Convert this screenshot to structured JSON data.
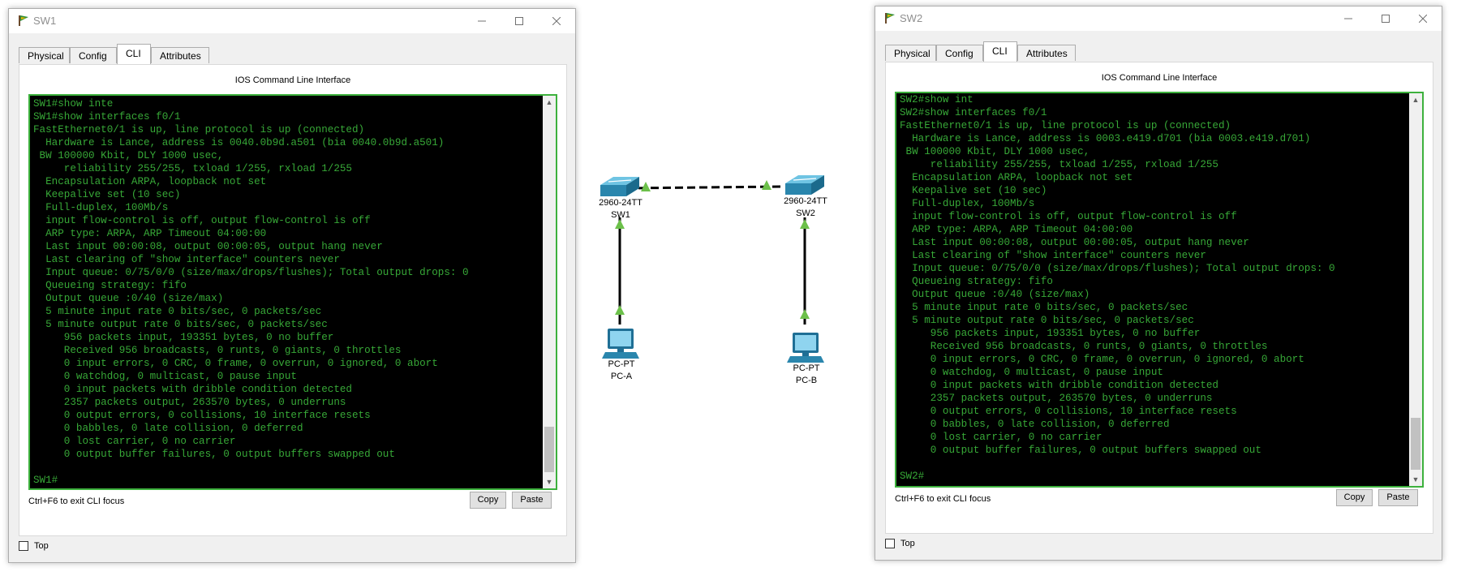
{
  "windows": [
    {
      "title": "SW1",
      "tabs": [
        "Physical",
        "Config",
        "CLI",
        "Attributes"
      ],
      "active_tab": "CLI",
      "panel_title": "IOS Command Line Interface",
      "terminal_lines": [
        "SW1#show inte",
        "SW1#show interfaces f0/1",
        "FastEthernet0/1 is up, line protocol is up (connected)",
        "  Hardware is Lance, address is 0040.0b9d.a501 (bia 0040.0b9d.a501)",
        " BW 100000 Kbit, DLY 1000 usec,",
        "     reliability 255/255, txload 1/255, rxload 1/255",
        "  Encapsulation ARPA, loopback not set",
        "  Keepalive set (10 sec)",
        "  Full-duplex, 100Mb/s",
        "  input flow-control is off, output flow-control is off",
        "  ARP type: ARPA, ARP Timeout 04:00:00",
        "  Last input 00:00:08, output 00:00:05, output hang never",
        "  Last clearing of \"show interface\" counters never",
        "  Input queue: 0/75/0/0 (size/max/drops/flushes); Total output drops: 0",
        "  Queueing strategy: fifo",
        "  Output queue :0/40 (size/max)",
        "  5 minute input rate 0 bits/sec, 0 packets/sec",
        "  5 minute output rate 0 bits/sec, 0 packets/sec",
        "     956 packets input, 193351 bytes, 0 no buffer",
        "     Received 956 broadcasts, 0 runts, 0 giants, 0 throttles",
        "     0 input errors, 0 CRC, 0 frame, 0 overrun, 0 ignored, 0 abort",
        "     0 watchdog, 0 multicast, 0 pause input",
        "     0 input packets with dribble condition detected",
        "     2357 packets output, 263570 bytes, 0 underruns",
        "     0 output errors, 0 collisions, 10 interface resets",
        "     0 babbles, 0 late collision, 0 deferred",
        "     0 lost carrier, 0 no carrier",
        "     0 output buffer failures, 0 output buffers swapped out",
        "",
        "SW1#"
      ],
      "exit_hint": "Ctrl+F6 to exit CLI focus",
      "copy_label": "Copy",
      "paste_label": "Paste",
      "top_label": "Top"
    },
    {
      "title": "SW2",
      "tabs": [
        "Physical",
        "Config",
        "CLI",
        "Attributes"
      ],
      "active_tab": "CLI",
      "panel_title": "IOS Command Line Interface",
      "terminal_lines": [
        "SW2#show int",
        "SW2#show interfaces f0/1",
        "FastEthernet0/1 is up, line protocol is up (connected)",
        "  Hardware is Lance, address is 0003.e419.d701 (bia 0003.e419.d701)",
        " BW 100000 Kbit, DLY 1000 usec,",
        "     reliability 255/255, txload 1/255, rxload 1/255",
        "  Encapsulation ARPA, loopback not set",
        "  Keepalive set (10 sec)",
        "  Full-duplex, 100Mb/s",
        "  input flow-control is off, output flow-control is off",
        "  ARP type: ARPA, ARP Timeout 04:00:00",
        "  Last input 00:00:08, output 00:00:05, output hang never",
        "  Last clearing of \"show interface\" counters never",
        "  Input queue: 0/75/0/0 (size/max/drops/flushes); Total output drops: 0",
        "  Queueing strategy: fifo",
        "  Output queue :0/40 (size/max)",
        "  5 minute input rate 0 bits/sec, 0 packets/sec",
        "  5 minute output rate 0 bits/sec, 0 packets/sec",
        "     956 packets input, 193351 bytes, 0 no buffer",
        "     Received 956 broadcasts, 0 runts, 0 giants, 0 throttles",
        "     0 input errors, 0 CRC, 0 frame, 0 overrun, 0 ignored, 0 abort",
        "     0 watchdog, 0 multicast, 0 pause input",
        "     0 input packets with dribble condition detected",
        "     2357 packets output, 263570 bytes, 0 underruns",
        "     0 output errors, 0 collisions, 10 interface resets",
        "     0 babbles, 0 late collision, 0 deferred",
        "     0 lost carrier, 0 no carrier",
        "     0 output buffer failures, 0 output buffers swapped out",
        "",
        "SW2#"
      ],
      "exit_hint": "Ctrl+F6 to exit CLI focus",
      "copy_label": "Copy",
      "paste_label": "Paste",
      "top_label": "Top"
    }
  ],
  "topology": {
    "sw1": {
      "model": "2960-24TT",
      "name": "SW1"
    },
    "sw2": {
      "model": "2960-24TT",
      "name": "SW2"
    },
    "pca": {
      "model": "PC-PT",
      "name": "PC-A"
    },
    "pcb": {
      "model": "PC-PT",
      "name": "PC-B"
    },
    "link_color": "#6cc04a"
  },
  "colors": {
    "terminal_bg": "#000000",
    "terminal_text": "#37a837",
    "terminal_border": "#3db13d"
  }
}
